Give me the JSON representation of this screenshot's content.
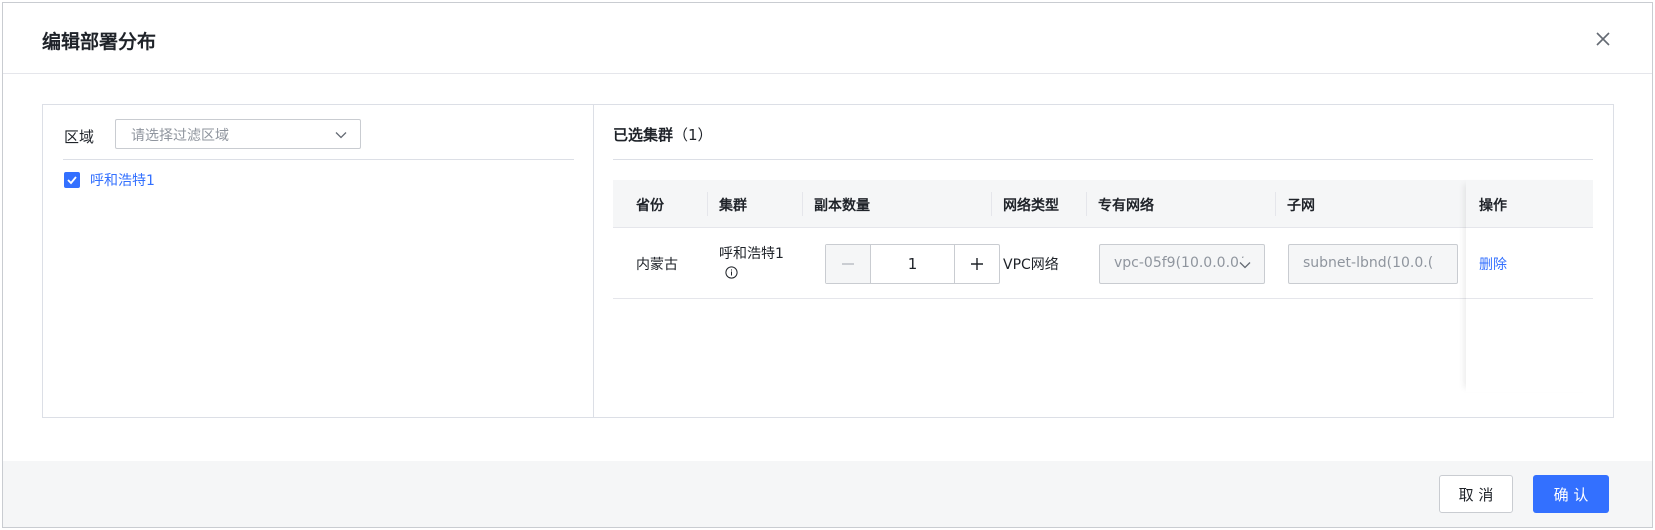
{
  "dialog": {
    "title": "编辑部署分布",
    "close_icon": "close-icon"
  },
  "filter": {
    "region_label": "区域",
    "region_placeholder": "请选择过滤区域",
    "options": [
      {
        "label": "呼和浩特1",
        "checked": true
      }
    ]
  },
  "selected": {
    "title": "已选集群",
    "count": "（1）",
    "columns": [
      "省份",
      "集群",
      "副本数量",
      "网络类型",
      "专有网络",
      "子网",
      "操作"
    ],
    "rows": [
      {
        "province": "内蒙古",
        "cluster": "呼和浩特1",
        "replicas": "1",
        "network_type": "VPC网络",
        "vpc": "vpc-05f9(10.0.0.0/",
        "subnet": "subnet-lbnd(10.0.(",
        "action": "删除"
      }
    ]
  },
  "footer": {
    "cancel_label": "取 消",
    "confirm_label": "确 认"
  },
  "colors": {
    "accent": "#3370ff",
    "border": "#c9ccd1",
    "muted": "#8f959e"
  }
}
